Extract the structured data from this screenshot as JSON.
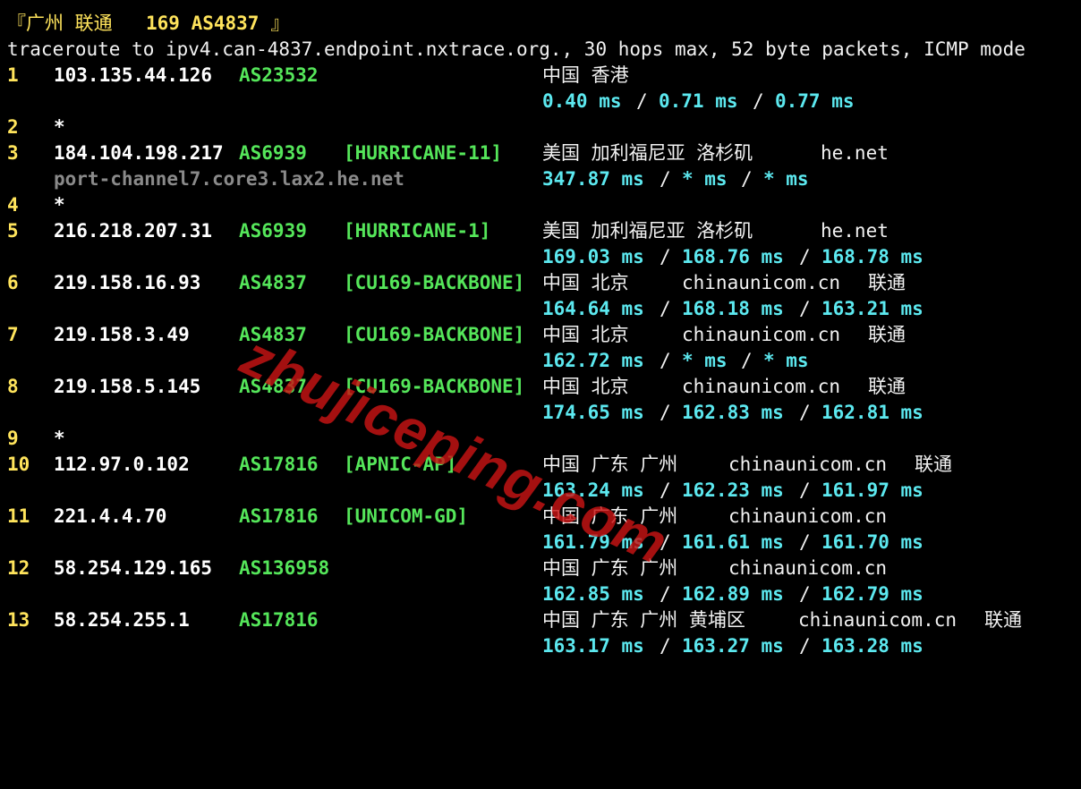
{
  "title": {
    "open": "『广州 联通 ",
    "bold": "169 AS4837",
    "close": " 』"
  },
  "header": "traceroute to ipv4.can-4837.endpoint.nxtrace.org., 30 hops max, 52 byte packets, ICMP mode",
  "hops": {
    "h1": {
      "n": "1",
      "ip": "103.135.44.126",
      "asn": "AS23532",
      "geo": "中国 香港",
      "lat1": "0.40 ms",
      "lat2": "0.71 ms",
      "lat3": "0.77 ms"
    },
    "h2": {
      "n": "2",
      "star": "*"
    },
    "h3": {
      "n": "3",
      "ip": "184.104.198.217",
      "asn": "AS6939",
      "tag": "[HURRICANE-11]",
      "geo": "美国 加利福尼亚 洛杉矶",
      "org": "he.net",
      "rdns": "port-channel7.core3.lax2.he.net",
      "lat1": "347.87 ms",
      "lat2": "* ms",
      "lat3": "* ms"
    },
    "h4": {
      "n": "4",
      "star": "*"
    },
    "h5": {
      "n": "5",
      "ip": "216.218.207.31",
      "asn": "AS6939",
      "tag": "[HURRICANE-1]",
      "geo": "美国 加利福尼亚 洛杉矶",
      "org": "he.net",
      "lat1": "169.03 ms",
      "lat2": "168.76 ms",
      "lat3": "168.78 ms"
    },
    "h6": {
      "n": "6",
      "ip": "219.158.16.93",
      "asn": "AS4837",
      "tag": "[CU169-BACKBONE]",
      "geo": "中国 北京",
      "org": "chinaunicom.cn",
      "isp": "联通",
      "lat1": "164.64 ms",
      "lat2": "168.18 ms",
      "lat3": "163.21 ms"
    },
    "h7": {
      "n": "7",
      "ip": "219.158.3.49",
      "asn": "AS4837",
      "tag": "[CU169-BACKBONE]",
      "geo": "中国 北京",
      "org": "chinaunicom.cn",
      "isp": "联通",
      "lat1": "162.72 ms",
      "lat2": "* ms",
      "lat3": "* ms"
    },
    "h8": {
      "n": "8",
      "ip": "219.158.5.145",
      "asn": "AS4837",
      "tag": "[CU169-BACKBONE]",
      "geo": "中国 北京",
      "org": "chinaunicom.cn",
      "isp": "联通",
      "lat1": "174.65 ms",
      "lat2": "162.83 ms",
      "lat3": "162.81 ms"
    },
    "h9": {
      "n": "9",
      "star": "*"
    },
    "h10": {
      "n": "10",
      "ip": "112.97.0.102",
      "asn": "AS17816",
      "tag": "[APNIC-AP]",
      "geo": "中国 广东 广州",
      "org": "chinaunicom.cn",
      "isp": "联通",
      "lat1": "163.24 ms",
      "lat2": "162.23 ms",
      "lat3": "161.97 ms"
    },
    "h11": {
      "n": "11",
      "ip": "221.4.4.70",
      "asn": "AS17816",
      "tag": "[UNICOM-GD]",
      "geo": "中国 广东 广州",
      "org": "chinaunicom.cn",
      "lat1": "161.79 ms",
      "lat2": "161.61 ms",
      "lat3": "161.70 ms"
    },
    "h12": {
      "n": "12",
      "ip": "58.254.129.165",
      "asn": "AS136958",
      "geo": "中国 广东 广州",
      "org": "chinaunicom.cn",
      "lat1": "162.85 ms",
      "lat2": "162.89 ms",
      "lat3": "162.79 ms"
    },
    "h13": {
      "n": "13",
      "ip": "58.254.255.1",
      "asn": "AS17816",
      "geo": "中国 广东 广州 黄埔区",
      "org": "chinaunicom.cn",
      "isp": "联通",
      "lat1": "163.17 ms",
      "lat2": "163.27 ms",
      "lat3": "163.28 ms"
    }
  },
  "slash": "/",
  "watermark": "zhujiceping.com",
  "colors": {
    "background": "#000000",
    "hop": "#ffe45c",
    "asn": "#55e65a",
    "latency": "#5ce8ef",
    "rdns": "#8a8a8a",
    "watermark": "#c81414"
  }
}
